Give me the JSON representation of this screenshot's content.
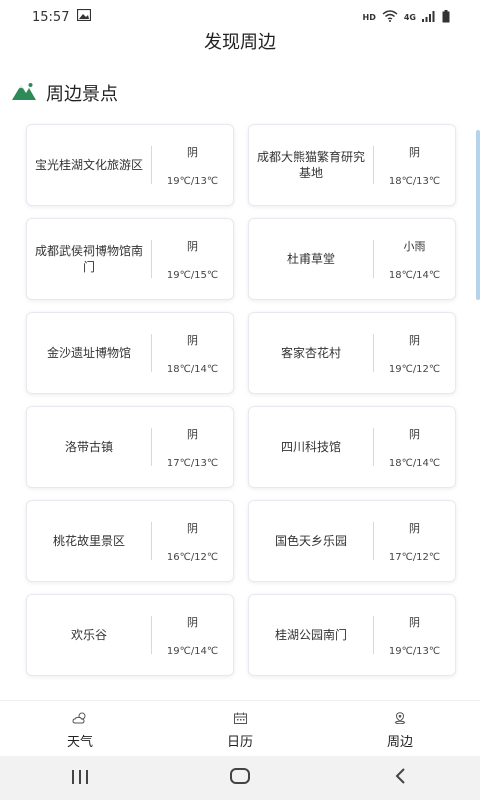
{
  "status_bar": {
    "time": "15:57",
    "hd": "HD",
    "network": "4G"
  },
  "page": {
    "title": "发现周边"
  },
  "section": {
    "title": "周边景点"
  },
  "spots": [
    {
      "name": "宝光桂湖文化旅游区",
      "condition": "阴",
      "temp": "19℃/13℃"
    },
    {
      "name": "成都大熊猫繁育研究基地",
      "condition": "阴",
      "temp": "18℃/13℃"
    },
    {
      "name": "成都武侯祠博物馆南门",
      "condition": "阴",
      "temp": "19℃/15℃"
    },
    {
      "name": "杜甫草堂",
      "condition": "小雨",
      "temp": "18℃/14℃"
    },
    {
      "name": "金沙遗址博物馆",
      "condition": "阴",
      "temp": "18℃/14℃"
    },
    {
      "name": "客家杏花村",
      "condition": "阴",
      "temp": "19℃/12℃"
    },
    {
      "name": "洛带古镇",
      "condition": "阴",
      "temp": "17℃/13℃"
    },
    {
      "name": "四川科技馆",
      "condition": "阴",
      "temp": "18℃/14℃"
    },
    {
      "name": "桃花故里景区",
      "condition": "阴",
      "temp": "16℃/12℃"
    },
    {
      "name": "国色天乡乐园",
      "condition": "阴",
      "temp": "17℃/12℃"
    },
    {
      "name": "欢乐谷",
      "condition": "阴",
      "temp": "19℃/14℃"
    },
    {
      "name": "桂湖公园南门",
      "condition": "阴",
      "temp": "19℃/13℃"
    }
  ],
  "tabs": [
    {
      "label": "天气",
      "icon": "weather-icon"
    },
    {
      "label": "日历",
      "icon": "calendar-icon"
    },
    {
      "label": "周边",
      "icon": "location-icon"
    }
  ],
  "colors": {
    "accent": "#2e8b57",
    "card_border": "#e6eaf0",
    "scroll": "#b5d3ea"
  }
}
